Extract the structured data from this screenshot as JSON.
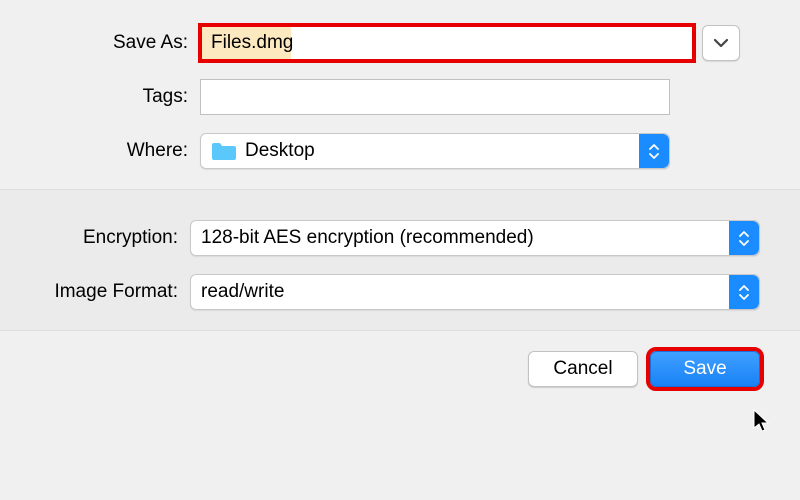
{
  "labels": {
    "save_as": "Save As:",
    "tags": "Tags:",
    "where": "Where:",
    "encryption": "Encryption:",
    "image_format": "Image Format:"
  },
  "fields": {
    "save_as_value": "Files.dmg",
    "tags_value": "",
    "where_value": "Desktop",
    "encryption_value": "128-bit AES encryption (recommended)",
    "image_format_value": "read/write"
  },
  "buttons": {
    "cancel": "Cancel",
    "save": "Save"
  },
  "colors": {
    "accent_blue": "#1a8cff",
    "highlight_red": "#e60000"
  }
}
